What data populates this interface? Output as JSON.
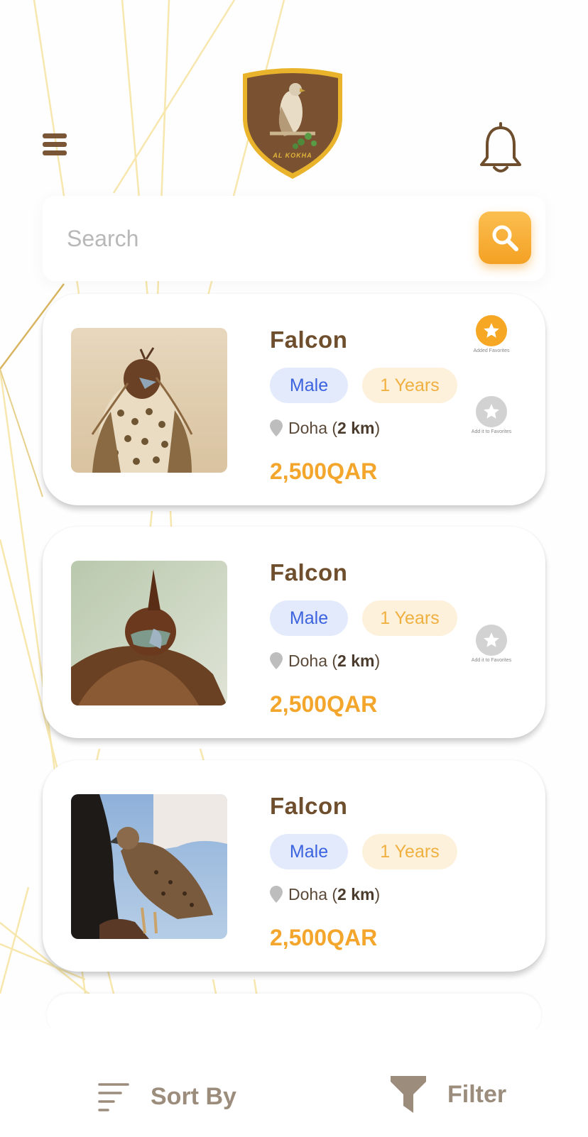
{
  "header": {
    "logo_text": "AL KOKHA"
  },
  "search": {
    "placeholder": "Search"
  },
  "listings": [
    {
      "title": "Falcon",
      "gender": "Male",
      "age": "1 Years",
      "location": "Doha",
      "distance": "2 km",
      "price": "2,500QAR",
      "favorites": [
        {
          "state": "added",
          "label": "Added Favorites"
        },
        {
          "state": "not-added",
          "label": "Add it to Favorites"
        }
      ]
    },
    {
      "title": "Falcon",
      "gender": "Male",
      "age": "1 Years",
      "location": "Doha",
      "distance": "2 km",
      "price": "2,500QAR",
      "favorites": [
        {
          "state": "not-added",
          "label": "Add it to Favorites"
        }
      ]
    },
    {
      "title": "Falcon",
      "gender": "Male",
      "age": "1 Years",
      "location": "Doha",
      "distance": "2 km",
      "price": "2,500QAR",
      "favorites": []
    }
  ],
  "bottom_bar": {
    "sort_label": "Sort By",
    "filter_label": "Filter"
  },
  "colors": {
    "brand_brown": "#6f4e2d",
    "accent_orange": "#f4a52b",
    "tag_blue": "#3b63e0",
    "tag_gold": "#f0b040"
  },
  "icons": [
    "menu-icon",
    "logo-emblem",
    "bell-icon",
    "search-icon",
    "star-icon",
    "location-pin-icon",
    "sort-icon",
    "filter-funnel-icon"
  ]
}
